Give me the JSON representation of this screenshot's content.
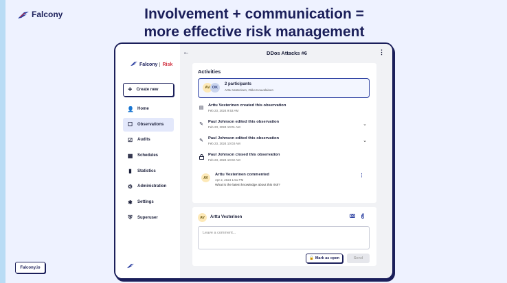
{
  "brand": {
    "name": "Falcony"
  },
  "headline": {
    "line1": "Involvement +  communication =",
    "line2": "more effective risk management"
  },
  "site_badge": "Falcony.io",
  "app": {
    "logo": {
      "name": "Falcony",
      "product": "Risk"
    },
    "create_button": "Create new",
    "nav": [
      {
        "label": "Home",
        "icon": "person-icon",
        "glyph": "👤",
        "active": false
      },
      {
        "label": "Observations",
        "icon": "observations-icon",
        "glyph": "☐",
        "active": true
      },
      {
        "label": "Audits",
        "icon": "checkbox-icon",
        "glyph": "☑",
        "active": false
      },
      {
        "label": "Schedules",
        "icon": "calendar-icon",
        "glyph": "▦",
        "active": false
      },
      {
        "label": "Statistics",
        "icon": "bar-chart-icon",
        "glyph": "▮",
        "active": false
      },
      {
        "label": "Administration",
        "icon": "admin-icon",
        "glyph": "⚙",
        "active": false
      },
      {
        "label": "Settings",
        "icon": "gear-icon",
        "glyph": "✱",
        "active": false
      },
      {
        "label": "Superuser",
        "icon": "shield-icon",
        "glyph": "⛨",
        "active": false
      }
    ]
  },
  "main": {
    "title": "DDos Attacks #6",
    "activities_title": "Activities",
    "participants": {
      "avatars": [
        "AV",
        "OK"
      ],
      "count_label": "2 participants",
      "names": "Arttu Vesterinen, Okko Kouvalainen"
    },
    "activities": [
      {
        "icon": "document-icon",
        "glyph": "▤",
        "text": "Arttu Vesterinen created this observation",
        "time": "Feb 23, 2024 9:53 AM",
        "expandable": false
      },
      {
        "icon": "pencil-icon",
        "glyph": "✎",
        "text": "Paul Johnson edited this observation",
        "time": "Feb 23, 2024 10:01 AM",
        "expandable": true
      },
      {
        "icon": "pencil-icon",
        "glyph": "✎",
        "text": "Paul Johnson edited this observation",
        "time": "Feb 23, 2024 10:03 AM",
        "expandable": true
      },
      {
        "icon": "lock-icon",
        "glyph": "🔒",
        "text": "Paul Johnson closed this observation",
        "time": "Feb 23, 2024 10:02 AM",
        "expandable": false
      }
    ],
    "comment": {
      "avatar": "AV",
      "author": "Arttu Vesterinen commented",
      "time": "Apr 2, 2024 1:51 PM",
      "body": "What is the latest knowledge about this risk?"
    },
    "composer": {
      "avatar": "AV",
      "author": "Arttu Vesterinen",
      "placeholder": "Leave a comment...",
      "mark_open_label": "Mark as open",
      "send_label": "Send"
    }
  }
}
